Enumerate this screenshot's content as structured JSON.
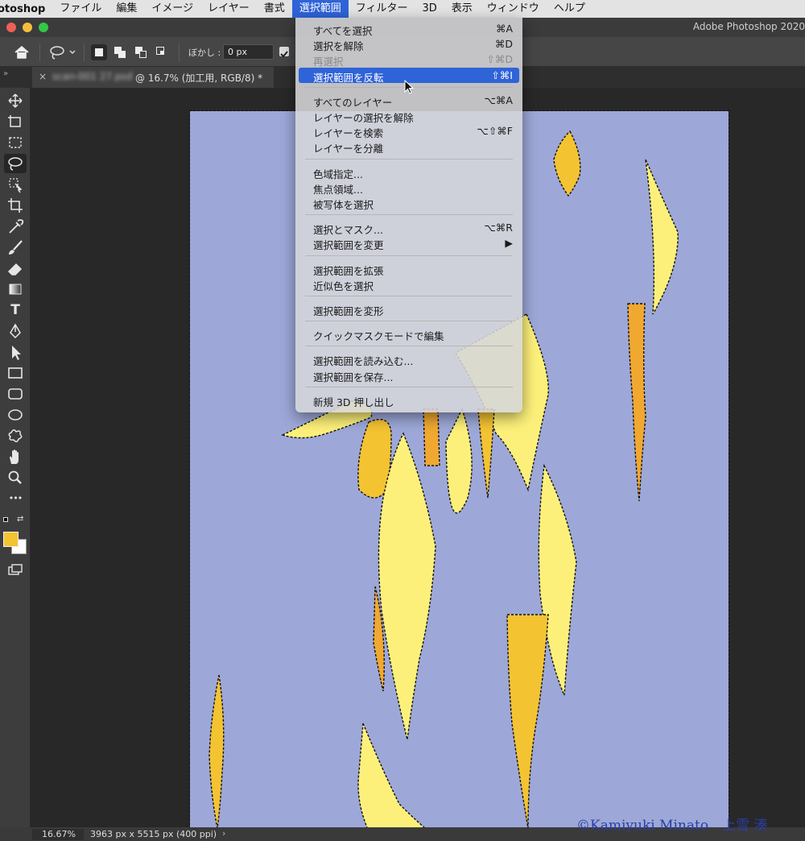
{
  "menubar": {
    "app_name": "otoshop",
    "items": [
      "ファイル",
      "編集",
      "イメージ",
      "レイヤー",
      "書式",
      "選択範囲",
      "フィルター",
      "3D",
      "表示",
      "ウィンドウ",
      "ヘルプ"
    ],
    "active_index": 5
  },
  "window": {
    "title": "Adobe Photoshop 2020"
  },
  "options": {
    "feather_label": "ぼかし :",
    "feather_value": "0 px"
  },
  "tab": {
    "close": "×",
    "filename_blurred": "scan-001 27.psd",
    "title_rest": "@ 16.7% (加工用, RGB/8) *"
  },
  "toolbar": {
    "tools": [
      "move-tool",
      "artboard-tool",
      "marquee-tool",
      "lasso-tool",
      "object-select-tool",
      "crop-tool",
      "eyedropper-tool",
      "brush-tool",
      "eraser-tool",
      "gradient-tool",
      "type-tool",
      "pen-tool",
      "path-select-tool",
      "rectangle-tool",
      "rounded-rect-tool",
      "ellipse-tool",
      "custom-shape-tool",
      "hand-tool",
      "zoom-tool",
      "more-tools"
    ],
    "type_glyph": "T",
    "more_glyph": "•••",
    "foreground_color": "#f3c332",
    "background_color": "#ffffff"
  },
  "selection_menu": {
    "sections": [
      [
        {
          "label": "すべてを選択",
          "shortcut": "⌘A"
        },
        {
          "label": "選択を解除",
          "shortcut": "⌘D"
        },
        {
          "label": "再選択",
          "shortcut": "⇧⌘D",
          "disabled": true
        },
        {
          "label": "選択範囲を反転",
          "shortcut": "⇧⌘I",
          "highlighted": true
        }
      ],
      [
        {
          "label": "すべてのレイヤー",
          "shortcut": "⌥⌘A"
        },
        {
          "label": "レイヤーの選択を解除",
          "shortcut": ""
        },
        {
          "label": "レイヤーを検索",
          "shortcut": "⌥⇧⌘F"
        },
        {
          "label": "レイヤーを分離",
          "shortcut": ""
        }
      ],
      [
        {
          "label": "色域指定...",
          "shortcut": ""
        },
        {
          "label": "焦点領域...",
          "shortcut": ""
        },
        {
          "label": "被写体を選択",
          "shortcut": ""
        }
      ],
      [
        {
          "label": "選択とマスク...",
          "shortcut": "⌥⌘R"
        },
        {
          "label": "選択範囲を変更",
          "shortcut": "▶"
        }
      ],
      [
        {
          "label": "選択範囲を拡張",
          "shortcut": ""
        },
        {
          "label": "近似色を選択",
          "shortcut": ""
        }
      ],
      [
        {
          "label": "選択範囲を変形",
          "shortcut": ""
        }
      ],
      [
        {
          "label": "クイックマスクモードで編集",
          "shortcut": ""
        }
      ],
      [
        {
          "label": "選択範囲を読み込む...",
          "shortcut": ""
        },
        {
          "label": "選択範囲を保存...",
          "shortcut": ""
        }
      ],
      [
        {
          "label": "新規 3D 押し出し",
          "shortcut": ""
        }
      ]
    ]
  },
  "status": {
    "zoom": "16.67%",
    "dimensions": "3963 px x 5515 px (400 ppi)"
  },
  "watermark": "©Kamiyuki Minato　上雪 湊",
  "colors": {
    "accent": "#2f63d8",
    "canvas_bg": "#9da8d8",
    "shape_light": "#fdf07a",
    "shape_gold": "#f3c332",
    "shape_orange": "#f0a830"
  }
}
